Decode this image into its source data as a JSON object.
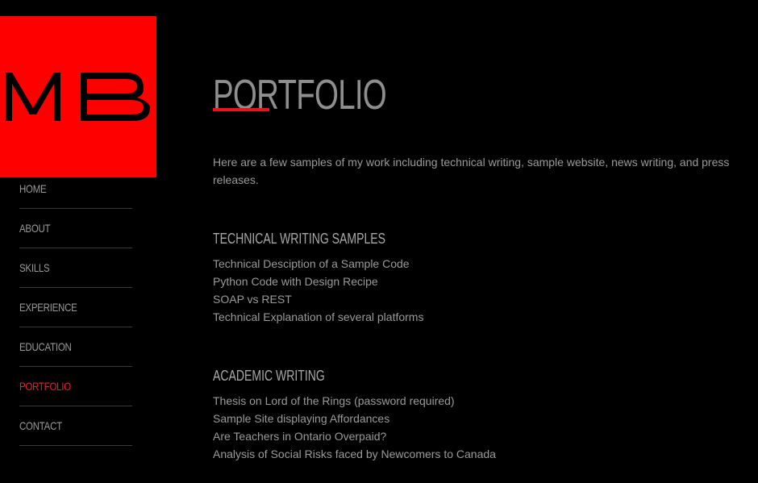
{
  "logo": {
    "text": "MB",
    "background": "#ff0000",
    "letter_color": "#000000"
  },
  "sidebar": {
    "items": [
      {
        "label": "HOME",
        "active": false
      },
      {
        "label": "ABOUT",
        "active": false
      },
      {
        "label": "SKILLS",
        "active": false
      },
      {
        "label": "EXPERIENCE",
        "active": false
      },
      {
        "label": "EDUCATION",
        "active": false
      },
      {
        "label": "PORTFOLIO",
        "active": true
      },
      {
        "label": "CONTACT",
        "active": false
      }
    ]
  },
  "main": {
    "title": "PORTFOLIO",
    "intro": "Here are a few samples of my work including technical writing, sample website, news writing, and press releases.",
    "sections": [
      {
        "heading": "TECHNICAL WRITING SAMPLES",
        "links": [
          "Technical Desciption of a Sample Code",
          "Python Code with Design Recipe",
          "SOAP vs REST",
          "Technical Explanation of several platforms"
        ]
      },
      {
        "heading": "ACADEMIC WRITING",
        "links": [
          "Thesis on Lord of the Rings (password required)",
          "Sample Site displaying Affordances",
          "Are Teachers in Ontario Overpaid?",
          "Analysis of Social Risks faced by Newcomers to Canada"
        ]
      }
    ]
  },
  "colors": {
    "background": "#000000",
    "accent": "#ff0000",
    "text": "#9a9a9a",
    "divider": "#3a3a3a"
  }
}
